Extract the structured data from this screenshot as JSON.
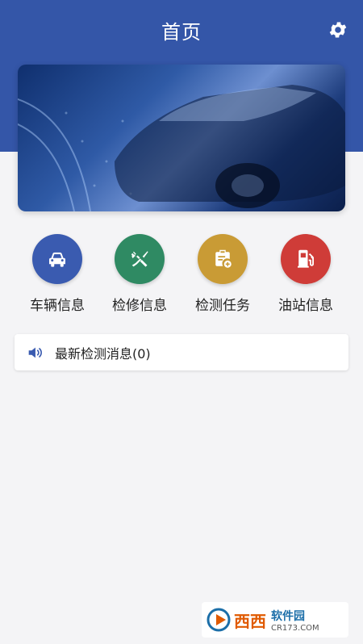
{
  "header": {
    "title": "首页"
  },
  "icons": {
    "settings": "gear-icon",
    "volume": "speaker-icon"
  },
  "colors": {
    "primary": "#3456a8",
    "vehicle": "#3a5bb0",
    "repair": "#2f8a63",
    "task": "#c99b35",
    "fuel": "#cf3c38"
  },
  "quick_menu": [
    {
      "label": "车辆信息",
      "icon": "car-icon"
    },
    {
      "label": "检修信息",
      "icon": "tools-icon"
    },
    {
      "label": "检测任务",
      "icon": "clipboard-icon"
    },
    {
      "label": "油站信息",
      "icon": "fuel-pump-icon"
    }
  ],
  "news": {
    "label": "最新检测消息(0)"
  },
  "watermark": {
    "main": "西西",
    "site": "软件园",
    "url": "CR173.COM"
  }
}
